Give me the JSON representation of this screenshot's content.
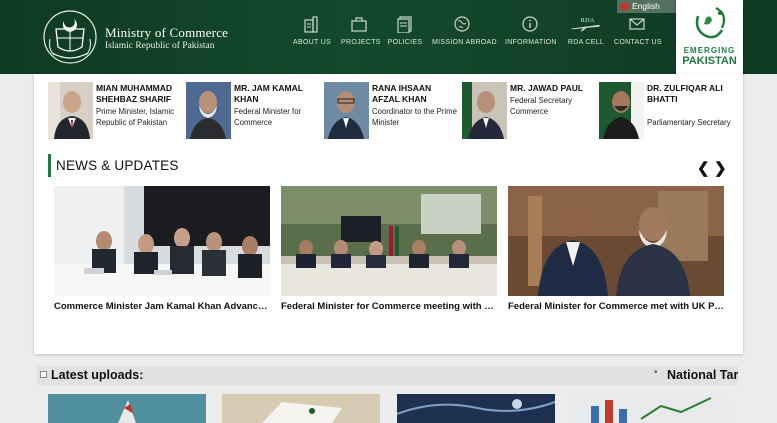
{
  "header": {
    "title": "Ministry of Commerce",
    "subtitle": "Islamic Republic of Pakistan",
    "nav": [
      {
        "label": "ABOUT US",
        "icon": "building-icon"
      },
      {
        "label": "PROJECTS",
        "icon": "briefcase-icon"
      },
      {
        "label": "POLICIES",
        "icon": "document-icon"
      },
      {
        "label": "MISSION ABROAD",
        "icon": "globe-icon"
      },
      {
        "label": "INFORMATION",
        "icon": "info-icon"
      },
      {
        "label": "RDA CELL",
        "icon": "airplane-icon",
        "badge": "RDA"
      },
      {
        "label": "CONTACT US",
        "icon": "envelope-icon"
      }
    ],
    "language": "English",
    "emerging_logo": {
      "line1": "EMERGING",
      "line2": "PAKISTAN"
    }
  },
  "officials": [
    {
      "name": "MIAN MUHAMMAD SHEHBAZ SHARIF",
      "role": "Prime Minister, Islamic Republic of Pakistan"
    },
    {
      "name": "MR. JAM KAMAL KHAN",
      "role": "Federal Minister for Commerce"
    },
    {
      "name": "RANA IHSAAN AFZAL KHAN",
      "role": "Coordinator to the Prime Minister"
    },
    {
      "name": "MR. JAWAD PAUL",
      "role": "Federal Secretary Commerce"
    },
    {
      "name": "DR. ZULFIQAR ALI BHATTI",
      "role": "Parliamentary Secretary"
    }
  ],
  "news": {
    "title": "NEWS & UPDATES",
    "prev": "❮",
    "next": "❯",
    "items": [
      {
        "caption": "Commerce Minister Jam Kamal Khan Advances Pakistan…"
      },
      {
        "caption": "Federal Minister for Commerce meeting with UK Minister…"
      },
      {
        "caption": "Federal Minister for Commerce met with UK Prime Minister…"
      }
    ]
  },
  "uploads": {
    "title": "Latest uploads:",
    "ticker": "National Tariff Policy"
  },
  "colors": {
    "header_green": "#14492c",
    "accent_green": "#1b7a3a",
    "nav_text": "#d9e6de"
  }
}
